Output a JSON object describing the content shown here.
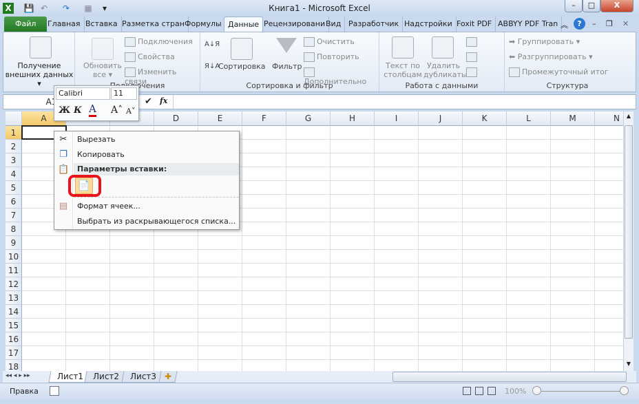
{
  "window": {
    "title": "Книга1  -  Microsoft Excel",
    "min": "–",
    "max": "□",
    "close": "X"
  },
  "quick_access": {
    "app": "X",
    "save": "💾",
    "undo": "↶",
    "redo": "↷",
    "extra": "▦",
    "customize": "▾"
  },
  "tabs": [
    {
      "label": "Файл"
    },
    {
      "label": "Главная"
    },
    {
      "label": "Вставка"
    },
    {
      "label": "Разметка стран"
    },
    {
      "label": "Формулы"
    },
    {
      "label": "Данные"
    },
    {
      "label": "Рецензировани"
    },
    {
      "label": "Вид"
    },
    {
      "label": "Разработчик"
    },
    {
      "label": "Надстройки"
    },
    {
      "label": "Foxit PDF"
    },
    {
      "label": "ABBYY PDF Tran"
    }
  ],
  "tab_right": {
    "collapse": "︽",
    "help": "?",
    "min": "–",
    "restore": "❐",
    "close": "✕"
  },
  "ribbon": {
    "external": {
      "label1": "Получение",
      "label2": "внешних данных ▾"
    },
    "connections": {
      "refresh1": "Обновить",
      "refresh2": "все ▾",
      "items": [
        "Подключения",
        "Свойства",
        "Изменить связи"
      ],
      "group": "Подключения"
    },
    "sort": {
      "az": "А↓Я",
      "za": "Я↓А",
      "sort": "Сортировка",
      "filter": "Фильтр",
      "items": [
        "Очистить",
        "Повторить",
        "Дополнительно"
      ],
      "group": "Сортировка и фильтр"
    },
    "datatools": {
      "text1": "Текст по",
      "text2": "столбцам",
      "dup1": "Удалить",
      "dup2": "дубликаты",
      "group": "Работа с данными"
    },
    "outline": {
      "items": [
        "Группировать ▾",
        "Разгруппировать ▾",
        "Промежуточный итог"
      ],
      "group": "Структура"
    }
  },
  "formula_bar": {
    "name_box": "A1",
    "fx": "fx",
    "enter": "✔",
    "value": ""
  },
  "mini_toolbar": {
    "font": "Calibri",
    "size": "11",
    "bold": "Ж",
    "italic": "К",
    "color": "A",
    "grow": "A˄",
    "shrink": "A˅",
    "font_color": "#e00000"
  },
  "columns": [
    "A",
    "B",
    "C",
    "D",
    "E",
    "F",
    "G",
    "H",
    "I",
    "J",
    "K",
    "L",
    "M",
    "N"
  ],
  "rows": [
    "1",
    "2",
    "3",
    "4",
    "5",
    "6",
    "7",
    "8",
    "9",
    "10",
    "11",
    "12",
    "13",
    "14",
    "15",
    "16",
    "17",
    "18"
  ],
  "context_menu": {
    "cut": "Вырезать",
    "copy": "Копировать",
    "paste_header": "Параметры вставки:",
    "format": "Формат ячеек...",
    "pick": "Выбрать из раскрывающегося списка...",
    "highlight_color": "#e8131b"
  },
  "sheets": {
    "nav": "◂◂ ◂ ▸ ▸▸",
    "tabs": [
      "Лист1",
      "Лист2",
      "Лист3"
    ],
    "new": "✚"
  },
  "status": {
    "mode": "Правка",
    "zoom": "100%"
  }
}
